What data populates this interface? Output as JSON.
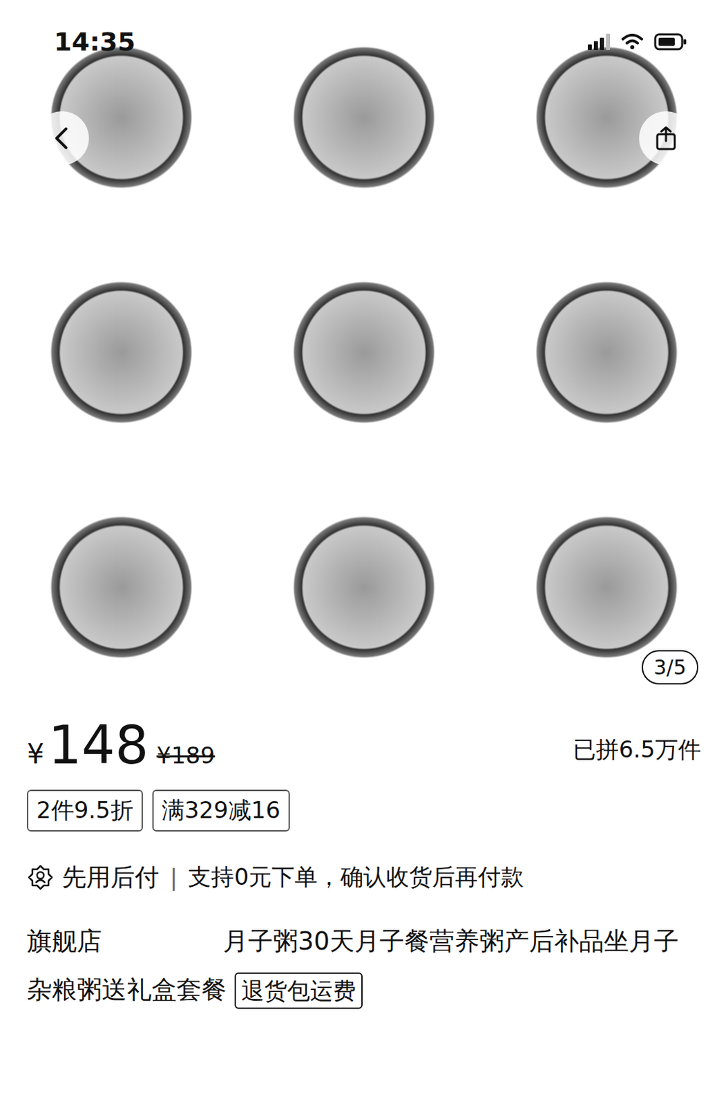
{
  "status_bar": {
    "time": "14:35"
  },
  "gallery": {
    "counter": "3/5"
  },
  "price": {
    "currency": "¥",
    "current": "148",
    "original": "¥189",
    "sold": "已拼6.5万件"
  },
  "promo_tags": [
    "2件9.5折",
    "满329减16"
  ],
  "pay_later": {
    "label": "先用后付",
    "separator": "|",
    "note": "支持0元下单，确认收货后再付款"
  },
  "title": {
    "store": "旗舰店",
    "text": "月子粥30天月子餐营养粥产后补品坐月子杂粮粥送礼盒套餐",
    "badge": "退货包运费"
  }
}
